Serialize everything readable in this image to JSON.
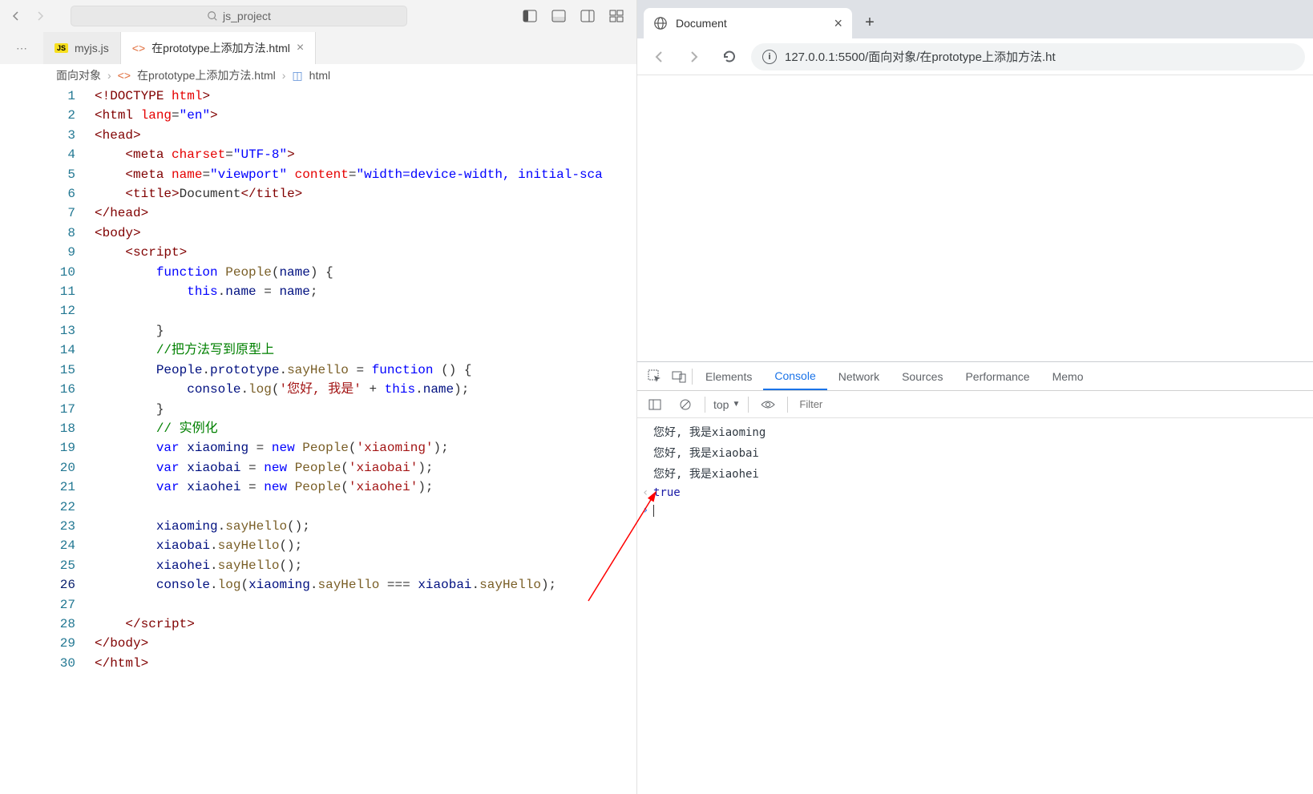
{
  "editor": {
    "search_placeholder": "js_project",
    "tabs": [
      {
        "icon": "js",
        "label": "myjs.js",
        "closable": false,
        "active": false
      },
      {
        "icon": "html",
        "label": "在prototype上添加方法.html",
        "closable": true,
        "active": true
      }
    ],
    "breadcrumb": {
      "seg1": "面向对象",
      "seg2": "在prototype上添加方法.html",
      "seg3": "html"
    },
    "line_count": 30,
    "current_line": 26,
    "code_tokens": [
      [
        [
          "pn",
          "<!"
        ],
        [
          "tag",
          "DOCTYPE"
        ],
        [
          "txt",
          " "
        ],
        [
          "attr",
          "html"
        ],
        [
          "pn",
          ">"
        ]
      ],
      [
        [
          "pn",
          "<"
        ],
        [
          "tag",
          "html"
        ],
        [
          "txt",
          " "
        ],
        [
          "attr",
          "lang"
        ],
        [
          "txt",
          "="
        ],
        [
          "str",
          "\"en\""
        ],
        [
          "pn",
          ">"
        ]
      ],
      [
        [
          "pn",
          "<"
        ],
        [
          "tag",
          "head"
        ],
        [
          "pn",
          ">"
        ]
      ],
      [
        [
          "txt",
          "    "
        ],
        [
          "pn",
          "<"
        ],
        [
          "tag",
          "meta"
        ],
        [
          "txt",
          " "
        ],
        [
          "attr",
          "charset"
        ],
        [
          "txt",
          "="
        ],
        [
          "str",
          "\"UTF-8\""
        ],
        [
          "pn",
          ">"
        ]
      ],
      [
        [
          "txt",
          "    "
        ],
        [
          "pn",
          "<"
        ],
        [
          "tag",
          "meta"
        ],
        [
          "txt",
          " "
        ],
        [
          "attr",
          "name"
        ],
        [
          "txt",
          "="
        ],
        [
          "str",
          "\"viewport\""
        ],
        [
          "txt",
          " "
        ],
        [
          "attr",
          "content"
        ],
        [
          "txt",
          "="
        ],
        [
          "str",
          "\"width=device-width, initial-sca"
        ]
      ],
      [
        [
          "txt",
          "    "
        ],
        [
          "pn",
          "<"
        ],
        [
          "tag",
          "title"
        ],
        [
          "pn",
          ">"
        ],
        [
          "txt",
          "Document"
        ],
        [
          "pn",
          "</"
        ],
        [
          "tag",
          "title"
        ],
        [
          "pn",
          ">"
        ]
      ],
      [
        [
          "pn",
          "</"
        ],
        [
          "tag",
          "head"
        ],
        [
          "pn",
          ">"
        ]
      ],
      [
        [
          "pn",
          "<"
        ],
        [
          "tag",
          "body"
        ],
        [
          "pn",
          ">"
        ]
      ],
      [
        [
          "txt",
          "    "
        ],
        [
          "pn",
          "<"
        ],
        [
          "tag",
          "script"
        ],
        [
          "pn",
          ">"
        ]
      ],
      [
        [
          "txt",
          "        "
        ],
        [
          "kw",
          "function"
        ],
        [
          "txt",
          " "
        ],
        [
          "fn",
          "People"
        ],
        [
          "txt",
          "("
        ],
        [
          "var",
          "name"
        ],
        [
          "txt",
          ") {"
        ]
      ],
      [
        [
          "txt",
          "            "
        ],
        [
          "this",
          "this"
        ],
        [
          "txt",
          "."
        ],
        [
          "var",
          "name"
        ],
        [
          "txt",
          " = "
        ],
        [
          "var",
          "name"
        ],
        [
          "txt",
          ";"
        ]
      ],
      [
        [
          "txt",
          ""
        ]
      ],
      [
        [
          "txt",
          "        }"
        ]
      ],
      [
        [
          "txt",
          "        "
        ],
        [
          "cm",
          "//把方法写到原型上"
        ]
      ],
      [
        [
          "txt",
          "        "
        ],
        [
          "var",
          "People"
        ],
        [
          "txt",
          "."
        ],
        [
          "var",
          "prototype"
        ],
        [
          "txt",
          "."
        ],
        [
          "fn",
          "sayHello"
        ],
        [
          "txt",
          " = "
        ],
        [
          "kw",
          "function"
        ],
        [
          "txt",
          " () {"
        ]
      ],
      [
        [
          "txt",
          "            "
        ],
        [
          "var",
          "console"
        ],
        [
          "txt",
          "."
        ],
        [
          "fn",
          "log"
        ],
        [
          "txt",
          "("
        ],
        [
          "rstr",
          "'您好, 我是'"
        ],
        [
          "txt",
          " + "
        ],
        [
          "this",
          "this"
        ],
        [
          "txt",
          "."
        ],
        [
          "var",
          "name"
        ],
        [
          "txt",
          ");"
        ]
      ],
      [
        [
          "txt",
          "        }"
        ]
      ],
      [
        [
          "txt",
          "        "
        ],
        [
          "cm",
          "// 实例化"
        ]
      ],
      [
        [
          "txt",
          "        "
        ],
        [
          "kw",
          "var"
        ],
        [
          "txt",
          " "
        ],
        [
          "var",
          "xiaoming"
        ],
        [
          "txt",
          " = "
        ],
        [
          "kw",
          "new"
        ],
        [
          "txt",
          " "
        ],
        [
          "fn",
          "People"
        ],
        [
          "txt",
          "("
        ],
        [
          "rstr",
          "'xiaoming'"
        ],
        [
          "txt",
          ");"
        ]
      ],
      [
        [
          "txt",
          "        "
        ],
        [
          "kw",
          "var"
        ],
        [
          "txt",
          " "
        ],
        [
          "var",
          "xiaobai"
        ],
        [
          "txt",
          " = "
        ],
        [
          "kw",
          "new"
        ],
        [
          "txt",
          " "
        ],
        [
          "fn",
          "People"
        ],
        [
          "txt",
          "("
        ],
        [
          "rstr",
          "'xiaobai'"
        ],
        [
          "txt",
          ");"
        ]
      ],
      [
        [
          "txt",
          "        "
        ],
        [
          "kw",
          "var"
        ],
        [
          "txt",
          " "
        ],
        [
          "var",
          "xiaohei"
        ],
        [
          "txt",
          " = "
        ],
        [
          "kw",
          "new"
        ],
        [
          "txt",
          " "
        ],
        [
          "fn",
          "People"
        ],
        [
          "txt",
          "("
        ],
        [
          "rstr",
          "'xiaohei'"
        ],
        [
          "txt",
          ");"
        ]
      ],
      [
        [
          "txt",
          ""
        ]
      ],
      [
        [
          "txt",
          "        "
        ],
        [
          "var",
          "xiaoming"
        ],
        [
          "txt",
          "."
        ],
        [
          "fn",
          "sayHello"
        ],
        [
          "txt",
          "();"
        ]
      ],
      [
        [
          "txt",
          "        "
        ],
        [
          "var",
          "xiaobai"
        ],
        [
          "txt",
          "."
        ],
        [
          "fn",
          "sayHello"
        ],
        [
          "txt",
          "();"
        ]
      ],
      [
        [
          "txt",
          "        "
        ],
        [
          "var",
          "xiaohei"
        ],
        [
          "txt",
          "."
        ],
        [
          "fn",
          "sayHello"
        ],
        [
          "txt",
          "();"
        ]
      ],
      [
        [
          "txt",
          "        "
        ],
        [
          "var",
          "console"
        ],
        [
          "txt",
          "."
        ],
        [
          "fn",
          "log"
        ],
        [
          "txt",
          "("
        ],
        [
          "var",
          "xiaoming"
        ],
        [
          "txt",
          "."
        ],
        [
          "fn",
          "sayHello"
        ],
        [
          "txt",
          " === "
        ],
        [
          "var",
          "xiaobai"
        ],
        [
          "txt",
          "."
        ],
        [
          "fn",
          "sayHello"
        ],
        [
          "txt",
          ");"
        ]
      ],
      [
        [
          "txt",
          ""
        ]
      ],
      [
        [
          "txt",
          "    "
        ],
        [
          "pn",
          "</"
        ],
        [
          "tag",
          "script"
        ],
        [
          "pn",
          ">"
        ]
      ],
      [
        [
          "pn",
          "</"
        ],
        [
          "tag",
          "body"
        ],
        [
          "pn",
          ">"
        ]
      ],
      [
        [
          "pn",
          "</"
        ],
        [
          "tag",
          "html"
        ],
        [
          "pn",
          ">"
        ]
      ]
    ]
  },
  "browser": {
    "tab_title": "Document",
    "url": "127.0.0.1:5500/面向对象/在prototype上添加方法.ht"
  },
  "devtools": {
    "tabs": [
      "Elements",
      "Console",
      "Network",
      "Sources",
      "Performance",
      "Memo"
    ],
    "active_tab": "Console",
    "context": "top",
    "filter_placeholder": "Filter",
    "console": [
      "您好, 我是xiaoming",
      "您好, 我是xiaobai",
      "您好, 我是xiaohei"
    ],
    "console_result": "true"
  }
}
